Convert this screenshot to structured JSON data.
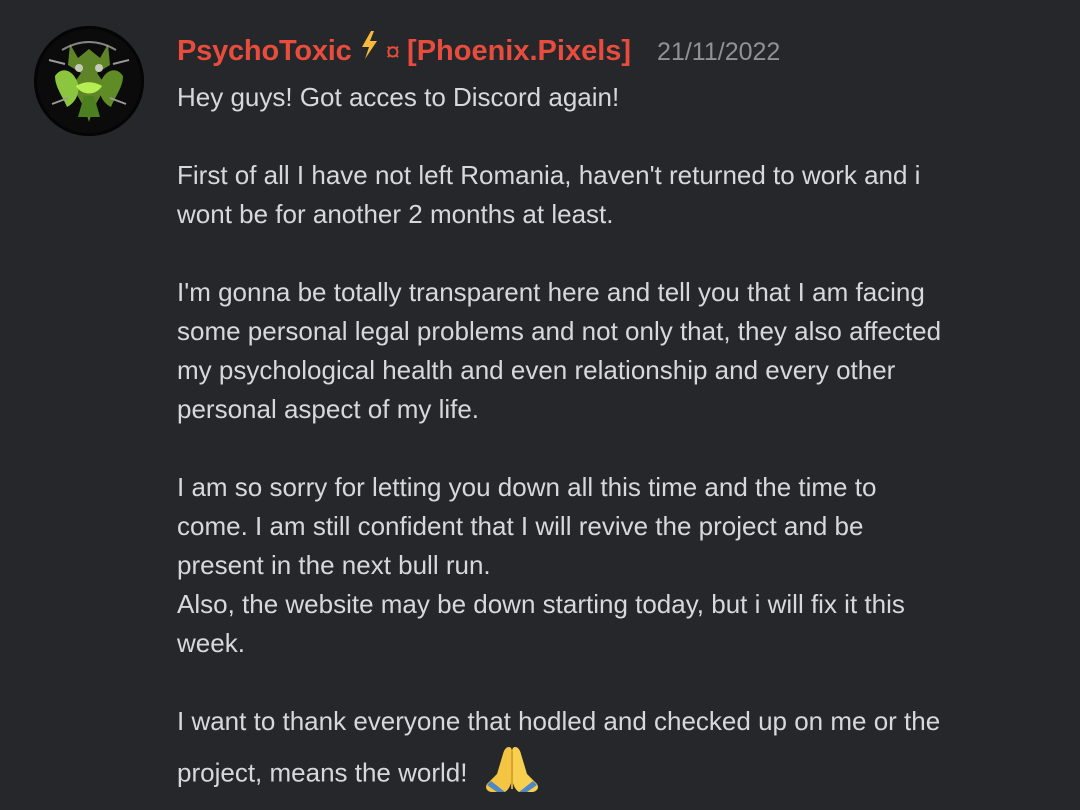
{
  "message": {
    "author": {
      "name": "PsychoToxic",
      "badge_symbol": "¤",
      "tag": "[Phoenix.Pixels]",
      "name_color": "#e74c3c",
      "icons": [
        "lightning-bolt-icon",
        "avatar-image"
      ]
    },
    "timestamp": "21/11/2022",
    "paragraphs": [
      [
        "Hey guys! Got acces to Discord again!"
      ],
      [
        "First of all I have not left Romania, haven't returned to work and i",
        "wont be for another 2 months at least."
      ],
      [
        "I'm gonna be totally transparent here and tell you that I am facing",
        "some personal legal problems and not only that, they also affected",
        "my psychological health and even relationship and every other",
        "personal aspect of my life."
      ],
      [
        "I am so sorry for letting you down all this time and the time to",
        "come. I am still confident that I will revive the project and be",
        "present in the next bull run.",
        "Also, the website may be down starting today, but i will fix it this",
        "week."
      ],
      [
        "I want to thank everyone that hodled and checked up on me or the",
        "project, means the world!"
      ]
    ],
    "emoji": "praying-hands-icon"
  },
  "colors": {
    "background": "#25272b",
    "text": "#d7d8dc",
    "timestamp": "#8e9297",
    "username": "#e74c3c"
  }
}
